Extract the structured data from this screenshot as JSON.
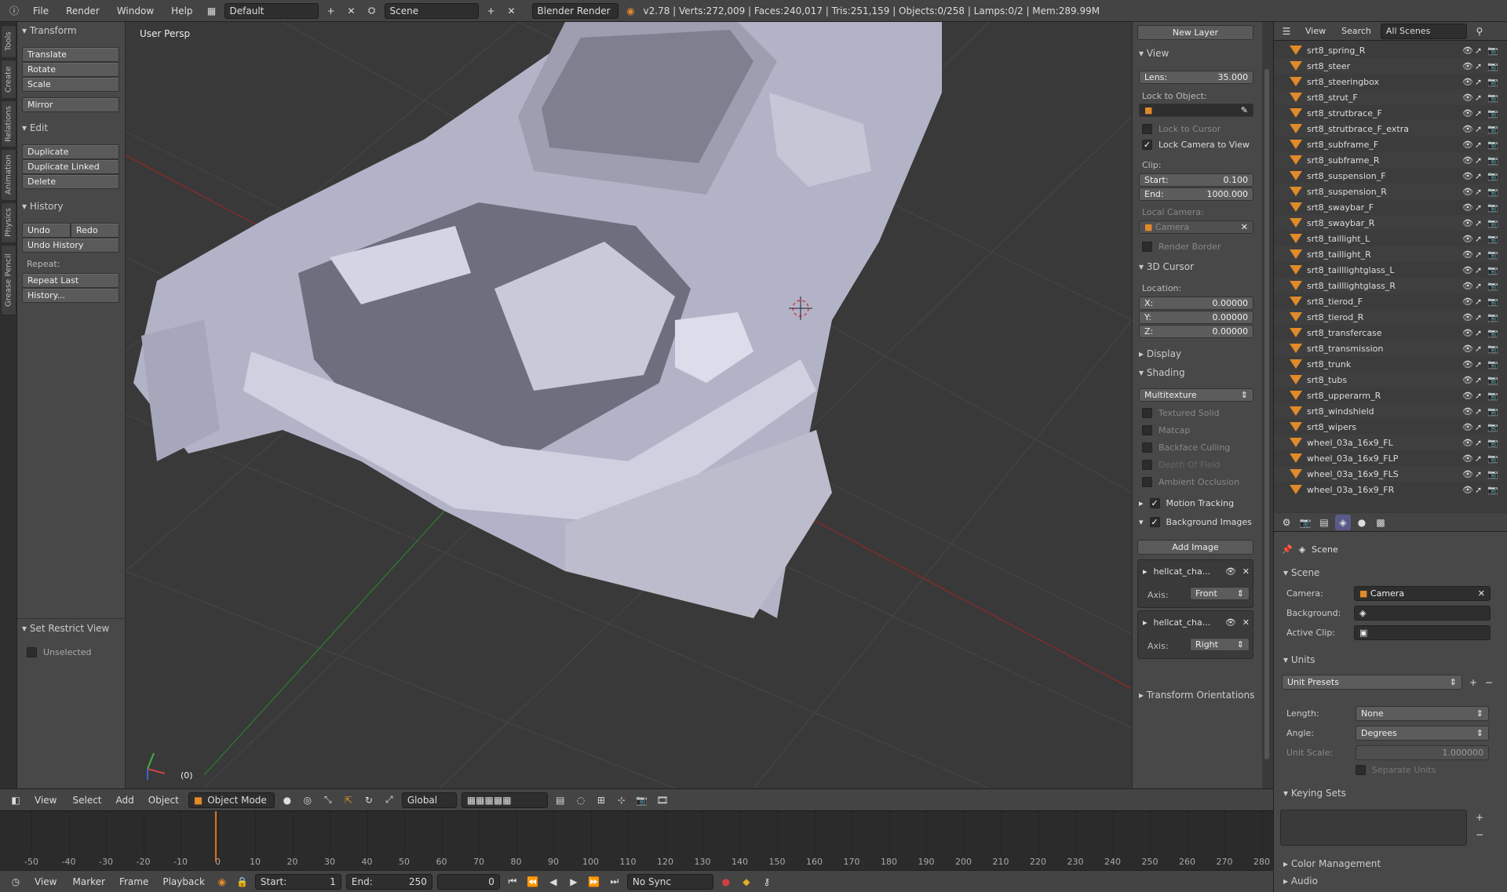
{
  "topbar": {
    "menus": [
      "File",
      "Render",
      "Window",
      "Help"
    ],
    "layout": "Default",
    "scene": "Scene",
    "engine": "Blender Render",
    "stats": "v2.78 | Verts:272,009 | Faces:240,017 | Tris:251,159 | Objects:0/258 | Lamps:0/2 | Mem:289.99M"
  },
  "tabs": [
    "Tools",
    "Create",
    "Relations",
    "Animation",
    "Physics",
    "Grease Pencil"
  ],
  "toolshelf": {
    "transform": "Transform",
    "translate": "Translate",
    "rotate": "Rotate",
    "scale": "Scale",
    "mirror": "Mirror",
    "edit": "Edit",
    "duplicate": "Duplicate",
    "duplicate_linked": "Duplicate Linked",
    "delete": "Delete",
    "history": "History",
    "undo": "Undo",
    "redo": "Redo",
    "undo_history": "Undo History",
    "repeat": "Repeat:",
    "repeat_last": "Repeat Last",
    "history_dots": "History...",
    "set_restrict": "Set Restrict View",
    "unselected": "Unselected"
  },
  "viewport": {
    "label": "User Persp",
    "frame": "(0)"
  },
  "npanel": {
    "new_layer": "New Layer",
    "view": "View",
    "lens_label": "Lens:",
    "lens_value": "35.000",
    "lock_object": "Lock to Object:",
    "lock_cursor": "Lock to Cursor",
    "lock_camera": "Lock Camera to View",
    "clip": "Clip:",
    "start_label": "Start:",
    "start_value": "0.100",
    "end_label": "End:",
    "end_value": "1000.000",
    "local_camera": "Local Camera:",
    "camera": "Camera",
    "render_border": "Render Border",
    "cursor3d": "3D Cursor",
    "location": "Location:",
    "x_label": "X:",
    "x_value": "0.00000",
    "y_label": "Y:",
    "y_value": "0.00000",
    "z_label": "Z:",
    "z_value": "0.00000",
    "display": "Display",
    "shading": "Shading",
    "shading_mode": "Multitexture",
    "textured_solid": "Textured Solid",
    "matcap": "Matcap",
    "backface": "Backface Culling",
    "dof": "Depth Of Field",
    "ao": "Ambient Occlusion",
    "motion_tracking": "Motion Tracking",
    "bg_images": "Background Images",
    "add_image": "Add Image",
    "img1_name": "hellcat_cha...",
    "img1_axis_label": "Axis:",
    "img1_axis": "Front",
    "img2_name": "hellcat_cha...",
    "img2_axis_label": "Axis:",
    "img2_axis": "Right",
    "transform_orient": "Transform Orientations"
  },
  "outliner": {
    "view": "View",
    "search": "Search",
    "scope": "All Scenes",
    "items": [
      "srt8_spring_R",
      "srt8_steer",
      "srt8_steeringbox",
      "srt8_strut_F",
      "srt8_strutbrace_F",
      "srt8_strutbrace_F_extra",
      "srt8_subframe_F",
      "srt8_subframe_R",
      "srt8_suspension_F",
      "srt8_suspension_R",
      "srt8_swaybar_F",
      "srt8_swaybar_R",
      "srt8_taillight_L",
      "srt8_taillight_R",
      "srt8_tailllightglass_L",
      "srt8_tailllightglass_R",
      "srt8_tierod_F",
      "srt8_tierod_R",
      "srt8_transfercase",
      "srt8_transmission",
      "srt8_trunk",
      "srt8_tubs",
      "srt8_upperarm_R",
      "srt8_windshield",
      "srt8_wipers",
      "wheel_03a_16x9_FL",
      "wheel_03a_16x9_FLP",
      "wheel_03a_16x9_FLS",
      "wheel_03a_16x9_FR"
    ]
  },
  "props": {
    "context": "Scene",
    "scene": "Scene",
    "camera_label": "Camera:",
    "camera_value": "Camera",
    "background_label": "Background:",
    "active_clip_label": "Active Clip:",
    "units": "Units",
    "unit_presets": "Unit Presets",
    "length_label": "Length:",
    "length_value": "None",
    "angle_label": "Angle:",
    "angle_value": "Degrees",
    "unit_scale_label": "Unit Scale:",
    "unit_scale_value": "1.000000",
    "separate_units": "Separate Units",
    "keying_sets": "Keying Sets",
    "color_mgmt": "Color Management",
    "audio": "Audio"
  },
  "v3dheader": {
    "view": "View",
    "select": "Select",
    "add": "Add",
    "object": "Object",
    "mode": "Object Mode",
    "orientation": "Global"
  },
  "timeline": {
    "ticks": [
      "-50",
      "-40",
      "-30",
      "-20",
      "-10",
      "0",
      "10",
      "20",
      "30",
      "40",
      "50",
      "60",
      "70",
      "80",
      "90",
      "100",
      "110",
      "120",
      "130",
      "140",
      "150",
      "160",
      "170",
      "180",
      "190",
      "200",
      "210",
      "220",
      "230",
      "240",
      "250",
      "260",
      "270",
      "280"
    ]
  },
  "tlheader": {
    "view": "View",
    "marker": "Marker",
    "frame": "Frame",
    "playback": "Playback",
    "start_label": "Start:",
    "start_value": "1",
    "end_label": "End:",
    "end_value": "250",
    "current": "0",
    "sync": "No Sync"
  }
}
